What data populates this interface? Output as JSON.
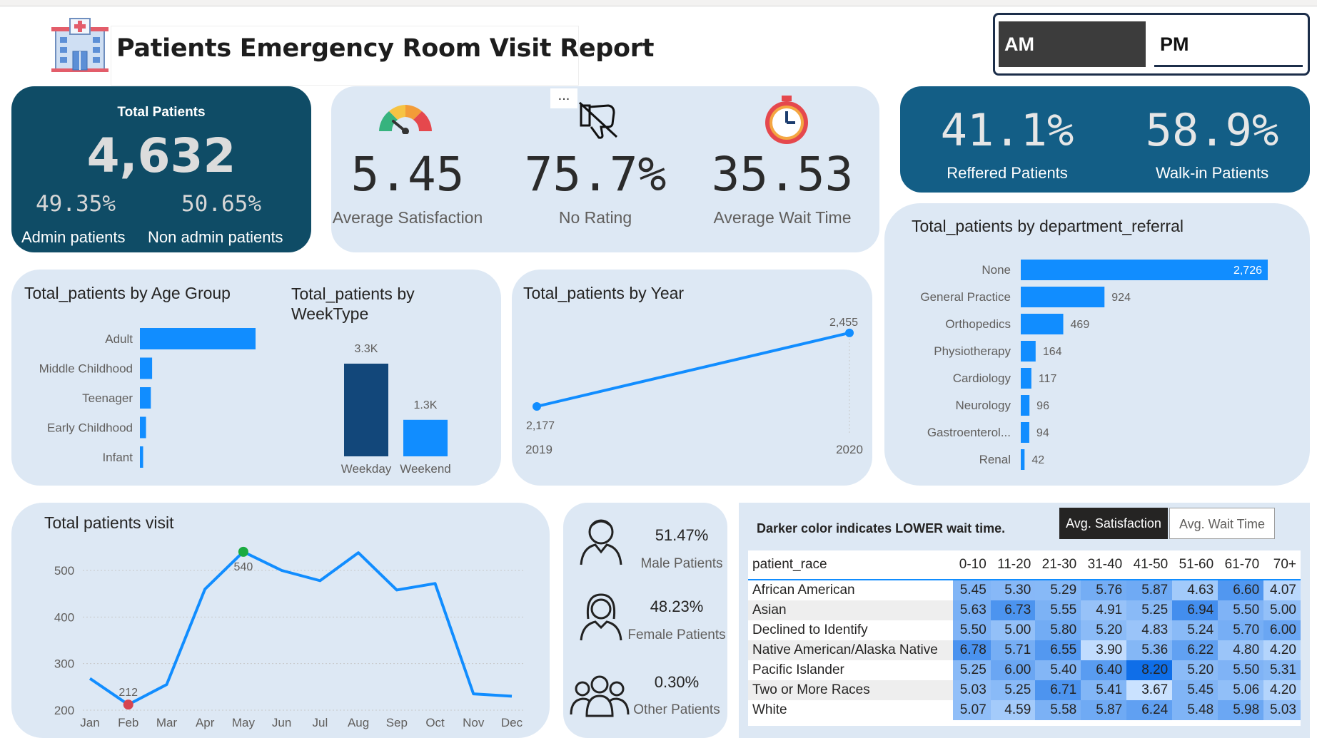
{
  "header": {
    "title": "Patients Emergency Room Visit Report",
    "am_label": "AM",
    "pm_label": "PM"
  },
  "total_patients": {
    "title": "Total Patients",
    "value": "4,632",
    "admin_pct": "49.35%",
    "admin_label": "Admin patients",
    "nonadmin_pct": "50.65%",
    "nonadmin_label": "Non admin patients"
  },
  "kpis": {
    "more": "...",
    "satisfaction_value": "5.45",
    "satisfaction_label": "Average Satisfaction",
    "norating_value": "75.7%",
    "norating_label": "No Rating",
    "wait_value": "35.53",
    "wait_label": "Average Wait Time"
  },
  "referral_kpis": {
    "referred_value": "41.1%",
    "referred_label": "Reffered Patients",
    "walkin_value": "58.9%",
    "walkin_label": "Walk-in Patients"
  },
  "gender": {
    "male_value": "51.47%",
    "male_label": "Male Patients",
    "female_value": "48.23%",
    "female_label": "Female Patients",
    "other_value": "0.30%",
    "other_label": "Other Patients"
  },
  "heatmap": {
    "note": "Darker color indicates LOWER wait time.",
    "btn_satisfaction": "Avg. Satisfaction",
    "btn_wait": "Avg. Wait Time",
    "row_header": "patient_race",
    "columns": [
      "0-10",
      "11-20",
      "21-30",
      "31-40",
      "41-50",
      "51-60",
      "61-70",
      "70+"
    ],
    "rows": [
      {
        "race": "African American",
        "values": [
          "5.45",
          "5.30",
          "5.29",
          "5.76",
          "5.87",
          "4.63",
          "6.60",
          "4.07"
        ]
      },
      {
        "race": "Asian",
        "values": [
          "5.63",
          "6.73",
          "5.55",
          "4.91",
          "5.25",
          "6.94",
          "5.50",
          "5.00"
        ]
      },
      {
        "race": "Declined to Identify",
        "values": [
          "5.50",
          "5.00",
          "5.80",
          "5.20",
          "4.83",
          "5.24",
          "5.70",
          "6.00"
        ]
      },
      {
        "race": "Native American/Alaska Native",
        "values": [
          "6.78",
          "5.71",
          "6.55",
          "3.90",
          "5.36",
          "6.22",
          "4.80",
          "4.20"
        ]
      },
      {
        "race": "Pacific Islander",
        "values": [
          "5.25",
          "6.00",
          "5.40",
          "6.40",
          "8.20",
          "5.20",
          "5.50",
          "5.31"
        ]
      },
      {
        "race": "Two or More Races",
        "values": [
          "5.03",
          "5.25",
          "6.71",
          "5.41",
          "3.67",
          "5.45",
          "5.06",
          "4.20"
        ]
      },
      {
        "race": "White",
        "values": [
          "5.07",
          "4.59",
          "5.58",
          "5.87",
          "6.24",
          "5.48",
          "5.98",
          "5.03"
        ]
      }
    ]
  },
  "chart_data": [
    {
      "type": "bar",
      "orientation": "horizontal",
      "title": "Total_patients by Age Group",
      "categories": [
        "Adult",
        "Middle Childhood",
        "Teenager",
        "Early Childhood",
        "Infant"
      ],
      "values": [
        3600,
        380,
        340,
        190,
        100
      ],
      "color": "#118dff"
    },
    {
      "type": "bar",
      "title": "Total_patients by WeekType",
      "categories": [
        "Weekday",
        "Weekend"
      ],
      "values": [
        3300,
        1300
      ],
      "data_labels": [
        "3.3K",
        "1.3K"
      ],
      "colors": [
        "#12477a",
        "#118dff"
      ]
    },
    {
      "type": "line",
      "title": "Total_patients by Year",
      "x": [
        "2019",
        "2020"
      ],
      "values": [
        2177,
        2455
      ],
      "data_labels": [
        "2,177",
        "2,455"
      ],
      "color": "#118dff"
    },
    {
      "type": "bar",
      "orientation": "horizontal",
      "title": "Total_patients by department_referral",
      "categories": [
        "None",
        "General Practice",
        "Orthopedics",
        "Physiotherapy",
        "Cardiology",
        "Neurology",
        "Gastroenterol...",
        "Renal"
      ],
      "values": [
        2726,
        924,
        469,
        164,
        117,
        96,
        94,
        42
      ],
      "data_labels": [
        "2,726",
        "924",
        "469",
        "164",
        "117",
        "96",
        "94",
        "42"
      ],
      "color": "#118dff"
    },
    {
      "type": "line",
      "title": "Total patients visit",
      "categories": [
        "Jan",
        "Feb",
        "Mar",
        "Apr",
        "May",
        "Jun",
        "Jul",
        "Aug",
        "Sep",
        "Oct",
        "Nov",
        "Dec"
      ],
      "values": [
        268,
        212,
        255,
        460,
        540,
        500,
        478,
        538,
        458,
        472,
        235,
        230
      ],
      "yticks": [
        "200",
        "300",
        "400",
        "500"
      ],
      "ylim": [
        200,
        560
      ],
      "min_label": "212",
      "max_label": "540",
      "color": "#118dff"
    }
  ]
}
